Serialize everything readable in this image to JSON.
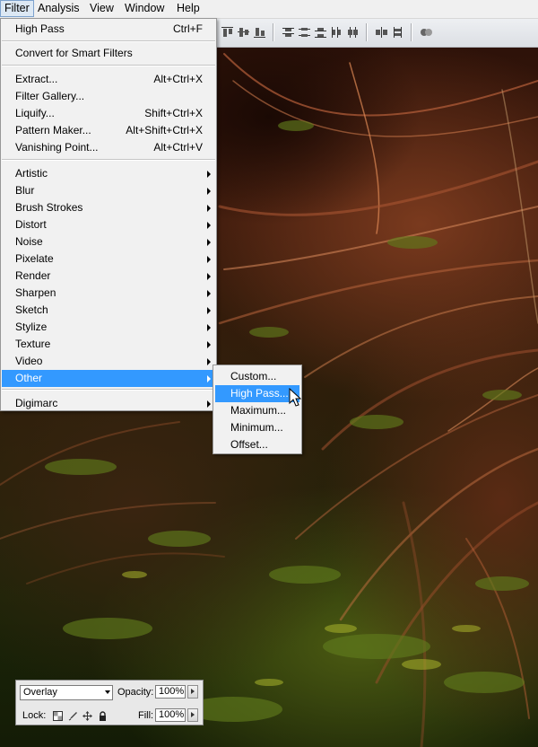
{
  "menubar": {
    "items": [
      {
        "label": "Filter",
        "active": true
      },
      {
        "label": "Analysis"
      },
      {
        "label": "View"
      },
      {
        "label": "Window"
      },
      {
        "label": "Help"
      }
    ]
  },
  "filter_menu": {
    "items": [
      {
        "label": "High Pass",
        "shortcut": "Ctrl+F"
      },
      {
        "label": "Convert for Smart Filters"
      },
      {
        "label": "Extract...",
        "shortcut": "Alt+Ctrl+X"
      },
      {
        "label": "Filter Gallery..."
      },
      {
        "label": "Liquify...",
        "shortcut": "Shift+Ctrl+X"
      },
      {
        "label": "Pattern Maker...",
        "shortcut": "Alt+Shift+Ctrl+X"
      },
      {
        "label": "Vanishing Point...",
        "shortcut": "Alt+Ctrl+V"
      },
      {
        "label": "Artistic"
      },
      {
        "label": "Blur"
      },
      {
        "label": "Brush Strokes"
      },
      {
        "label": "Distort"
      },
      {
        "label": "Noise"
      },
      {
        "label": "Pixelate"
      },
      {
        "label": "Render"
      },
      {
        "label": "Sharpen"
      },
      {
        "label": "Sketch"
      },
      {
        "label": "Stylize"
      },
      {
        "label": "Texture"
      },
      {
        "label": "Video"
      },
      {
        "label": "Other",
        "highlighted": true
      },
      {
        "label": "Digimarc"
      }
    ]
  },
  "other_submenu": {
    "items": [
      {
        "label": "Custom..."
      },
      {
        "label": "High Pass...",
        "highlighted": true
      },
      {
        "label": "Maximum..."
      },
      {
        "label": "Minimum..."
      },
      {
        "label": "Offset..."
      }
    ]
  },
  "layers_panel": {
    "blend_mode": "Overlay",
    "opacity_label": "Opacity:",
    "opacity_value": "100%",
    "lock_label": "Lock:",
    "fill_label": "Fill:",
    "fill_value": "100%"
  },
  "colors": {
    "highlight": "#3399ff",
    "menu_bg": "#f1f1f1",
    "menubar_bg": "#f0f0f0"
  },
  "icons": [
    "align-top-icon",
    "align-vcenter-icon",
    "align-bottom-icon",
    "align-left-icon",
    "align-hcenter-icon",
    "align-right-icon",
    "distribute-top-icon",
    "distribute-vcenter-icon",
    "distribute-bottom-icon",
    "distribute-left-icon",
    "distribute-hcenter-icon",
    "distribute-right-icon",
    "auto-align-icon",
    "submenu-arrow-icon",
    "pointer-cursor-icon",
    "lock-transparency-icon",
    "lock-paint-icon",
    "lock-move-icon",
    "lock-all-icon"
  ]
}
